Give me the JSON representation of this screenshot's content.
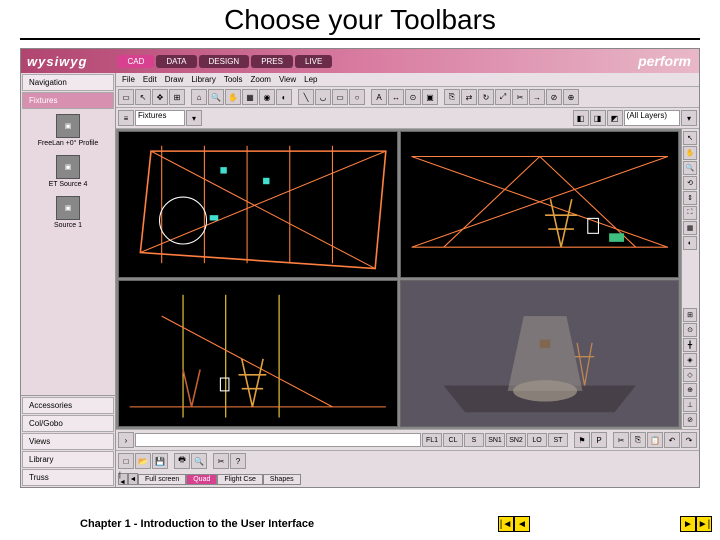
{
  "slide": {
    "title": "Choose your Toolbars",
    "footer": "Chapter 1 - Introduction to the User Interface"
  },
  "app": {
    "logo": "wysiwyg",
    "perform": "perform",
    "modes": [
      "CAD",
      "DATA",
      "DESIGN",
      "PRES",
      "LIVE"
    ],
    "active_mode": "CAD",
    "menubar": [
      "File",
      "Edit",
      "Draw",
      "Library",
      "Tools",
      "Zoom",
      "View",
      "Lep"
    ],
    "sidebar": {
      "top_items": [
        "Navigation",
        "Fixtures"
      ],
      "selected": "Fixtures",
      "fixtures": [
        "FreeLan +0° Profile",
        "ET Source 4",
        "Source 1"
      ],
      "bottom_items": [
        "Accessories",
        "Col/Gobo",
        "Views",
        "Library",
        "Truss"
      ]
    },
    "toolbar2": {
      "fixtures_label": "Fixtures",
      "layers_label": "(All Layers)"
    },
    "view_tabs": [
      "Full screen",
      "Quad",
      "Flight Cse",
      "Shapes"
    ],
    "active_tab": "Quad",
    "status_icons": [
      "FL1",
      "CL",
      "S",
      "SN1",
      "SN2",
      "LO",
      "ST"
    ]
  },
  "nav": {
    "prev": "◄",
    "first": "|◄",
    "next": "►",
    "last": "►|"
  }
}
